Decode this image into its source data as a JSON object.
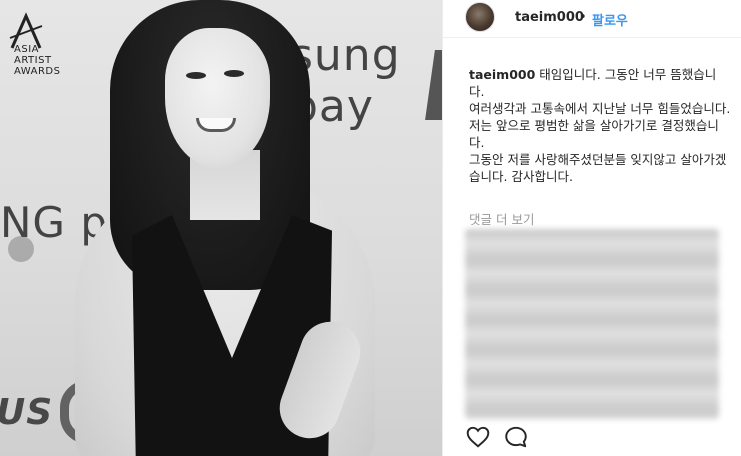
{
  "photo": {
    "backdrop": {
      "pay_top": "sung pay",
      "pay_mid": "NG pay",
      "us_text": "US",
      "logo_lines": [
        "ASIA",
        "ARTIST",
        "AWARDS"
      ]
    }
  },
  "post": {
    "header": {
      "username": "taeim000",
      "separator": "•",
      "follow_label": "팔로우"
    },
    "caption": {
      "username": "taeim000",
      "lines": [
        "태임입니다. 그동안 너무 뜸했습니다.",
        "여러생각과 고통속에서 지난날 너무 힘들었습니다.",
        "저는 앞으로 평범한 삶을 살아가기로 결정했습니다.",
        "그동안 저를 사랑해주셨던분들 잊지않고 살아가겠습니다. 감사합니다."
      ]
    },
    "more_comments": "댓글 더 보기",
    "actions": {
      "like_icon": "heart-icon",
      "comment_icon": "comment-icon"
    }
  },
  "colors": {
    "link_blue": "#3897f0",
    "text": "#262626",
    "muted": "#999999"
  }
}
